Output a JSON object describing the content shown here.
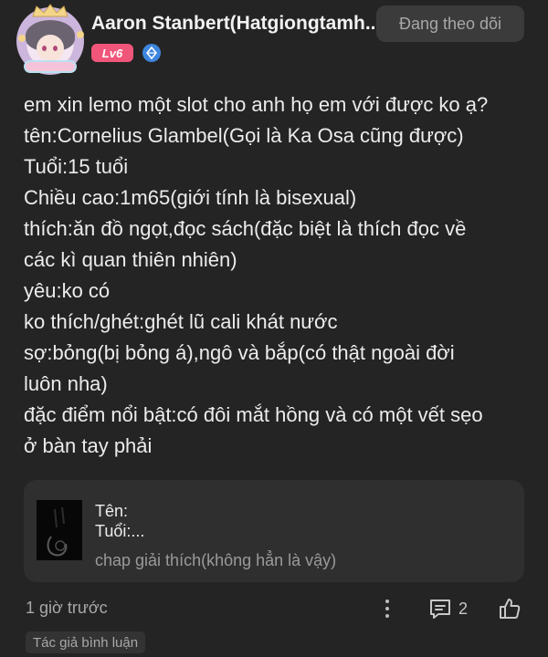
{
  "header": {
    "username": "Aaron Stanbert(Hatgiongtamh...",
    "level": "Lv6",
    "follow_label": "Đang theo dõi"
  },
  "post": {
    "lines": [
      "em xin lemo một slot cho anh họ em với được ko ạ?",
      "tên:Cornelius Glambel(Gọi là Ka Osa cũng được)",
      "Tuổi:15 tuổi",
      "Chiều cao:1m65(giới tính là bisexual)",
      "thích:ăn đồ ngọt,đọc sách(đặc biệt là thích đọc về",
      "các kì quan thiên nhiên)",
      "yêu:ko có",
      "ko thích/ghét:ghét lũ cali khát nước",
      "sợ:bỏng(bị bỏng á),ngô và bắp(có thật ngoài đời",
      "luôn nha)",
      "đặc điểm nổi bật:có đôi mắt hồng và có một vết sẹo",
      "ở bàn tay phải"
    ]
  },
  "quote": {
    "title": "Tên:",
    "subtitle": "Tuổi:...",
    "caption": "chap giải thích(không hẳn là vậy)"
  },
  "footer": {
    "timestamp": "1 giờ trước",
    "comment_count": "2",
    "author_badge": "Tác giả bình luận"
  },
  "icons": {
    "verify": "diamond-badge-icon",
    "more": "more-vertical-icon",
    "comment": "comment-icon",
    "like": "thumbs-up-icon"
  },
  "colors": {
    "background": "#242424",
    "level_badge": "#f0567a",
    "verify_badge": "#3d86e0",
    "card": "#2f2f2f"
  }
}
